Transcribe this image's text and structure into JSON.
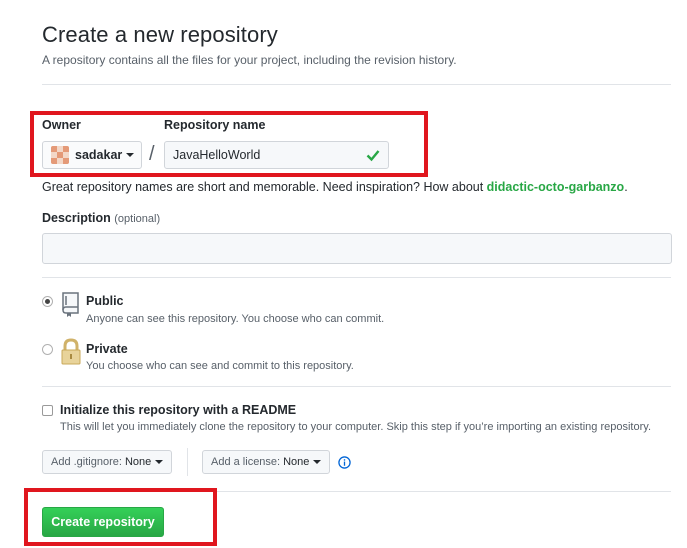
{
  "header": {
    "title": "Create a new repository",
    "subtitle": "A repository contains all the files for your project, including the revision history."
  },
  "owner": {
    "label": "Owner",
    "value": "sadakar"
  },
  "separator": "/",
  "repo_name": {
    "label": "Repository name",
    "value": "JavaHelloWorld",
    "valid": true
  },
  "name_hint": {
    "text": "Great repository names are short and memorable. Need inspiration? How about ",
    "suggestion": "didactic-octo-garbanzo",
    "end": "."
  },
  "description": {
    "label": "Description",
    "optional": "(optional)",
    "value": ""
  },
  "visibility": {
    "selected": "public",
    "public": {
      "title": "Public",
      "note": "Anyone can see this repository. You choose who can commit."
    },
    "private": {
      "title": "Private",
      "note": "You choose who can see and commit to this repository."
    }
  },
  "readme": {
    "checked": false,
    "title": "Initialize this repository with a README",
    "note": "This will let you immediately clone the repository to your computer. Skip this step if you’re importing an existing repository."
  },
  "gitignore": {
    "label": "Add .gitignore:",
    "value": "None"
  },
  "license": {
    "label": "Add a license:",
    "value": "None"
  },
  "submit": {
    "label": "Create repository"
  },
  "colors": {
    "highlight": "#e0161e",
    "accent_green": "#28a745",
    "info_blue": "#0366d6"
  },
  "icons": {
    "public": "repo-book-icon",
    "private": "lock-icon",
    "valid": "check-icon",
    "info": "info-icon"
  }
}
